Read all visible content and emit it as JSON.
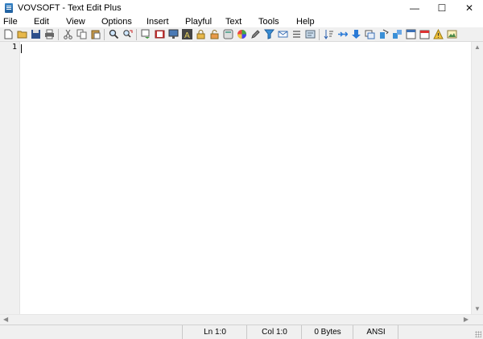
{
  "window": {
    "title": "VOVSOFT - Text Edit Plus",
    "minimize": "—",
    "maximize": "☐",
    "close": "✕"
  },
  "menu": [
    "File",
    "Edit",
    "View",
    "Options",
    "Insert",
    "Playful",
    "Text",
    "Tools",
    "Help"
  ],
  "editor": {
    "line_number": "1",
    "content": ""
  },
  "scrollbars": {
    "up": "▲",
    "down": "▼",
    "left": "◀",
    "right": "▶"
  },
  "status": {
    "line": "Ln 1:0",
    "col": "Col 1:0",
    "size": "0 Bytes",
    "encoding": "ANSI"
  }
}
